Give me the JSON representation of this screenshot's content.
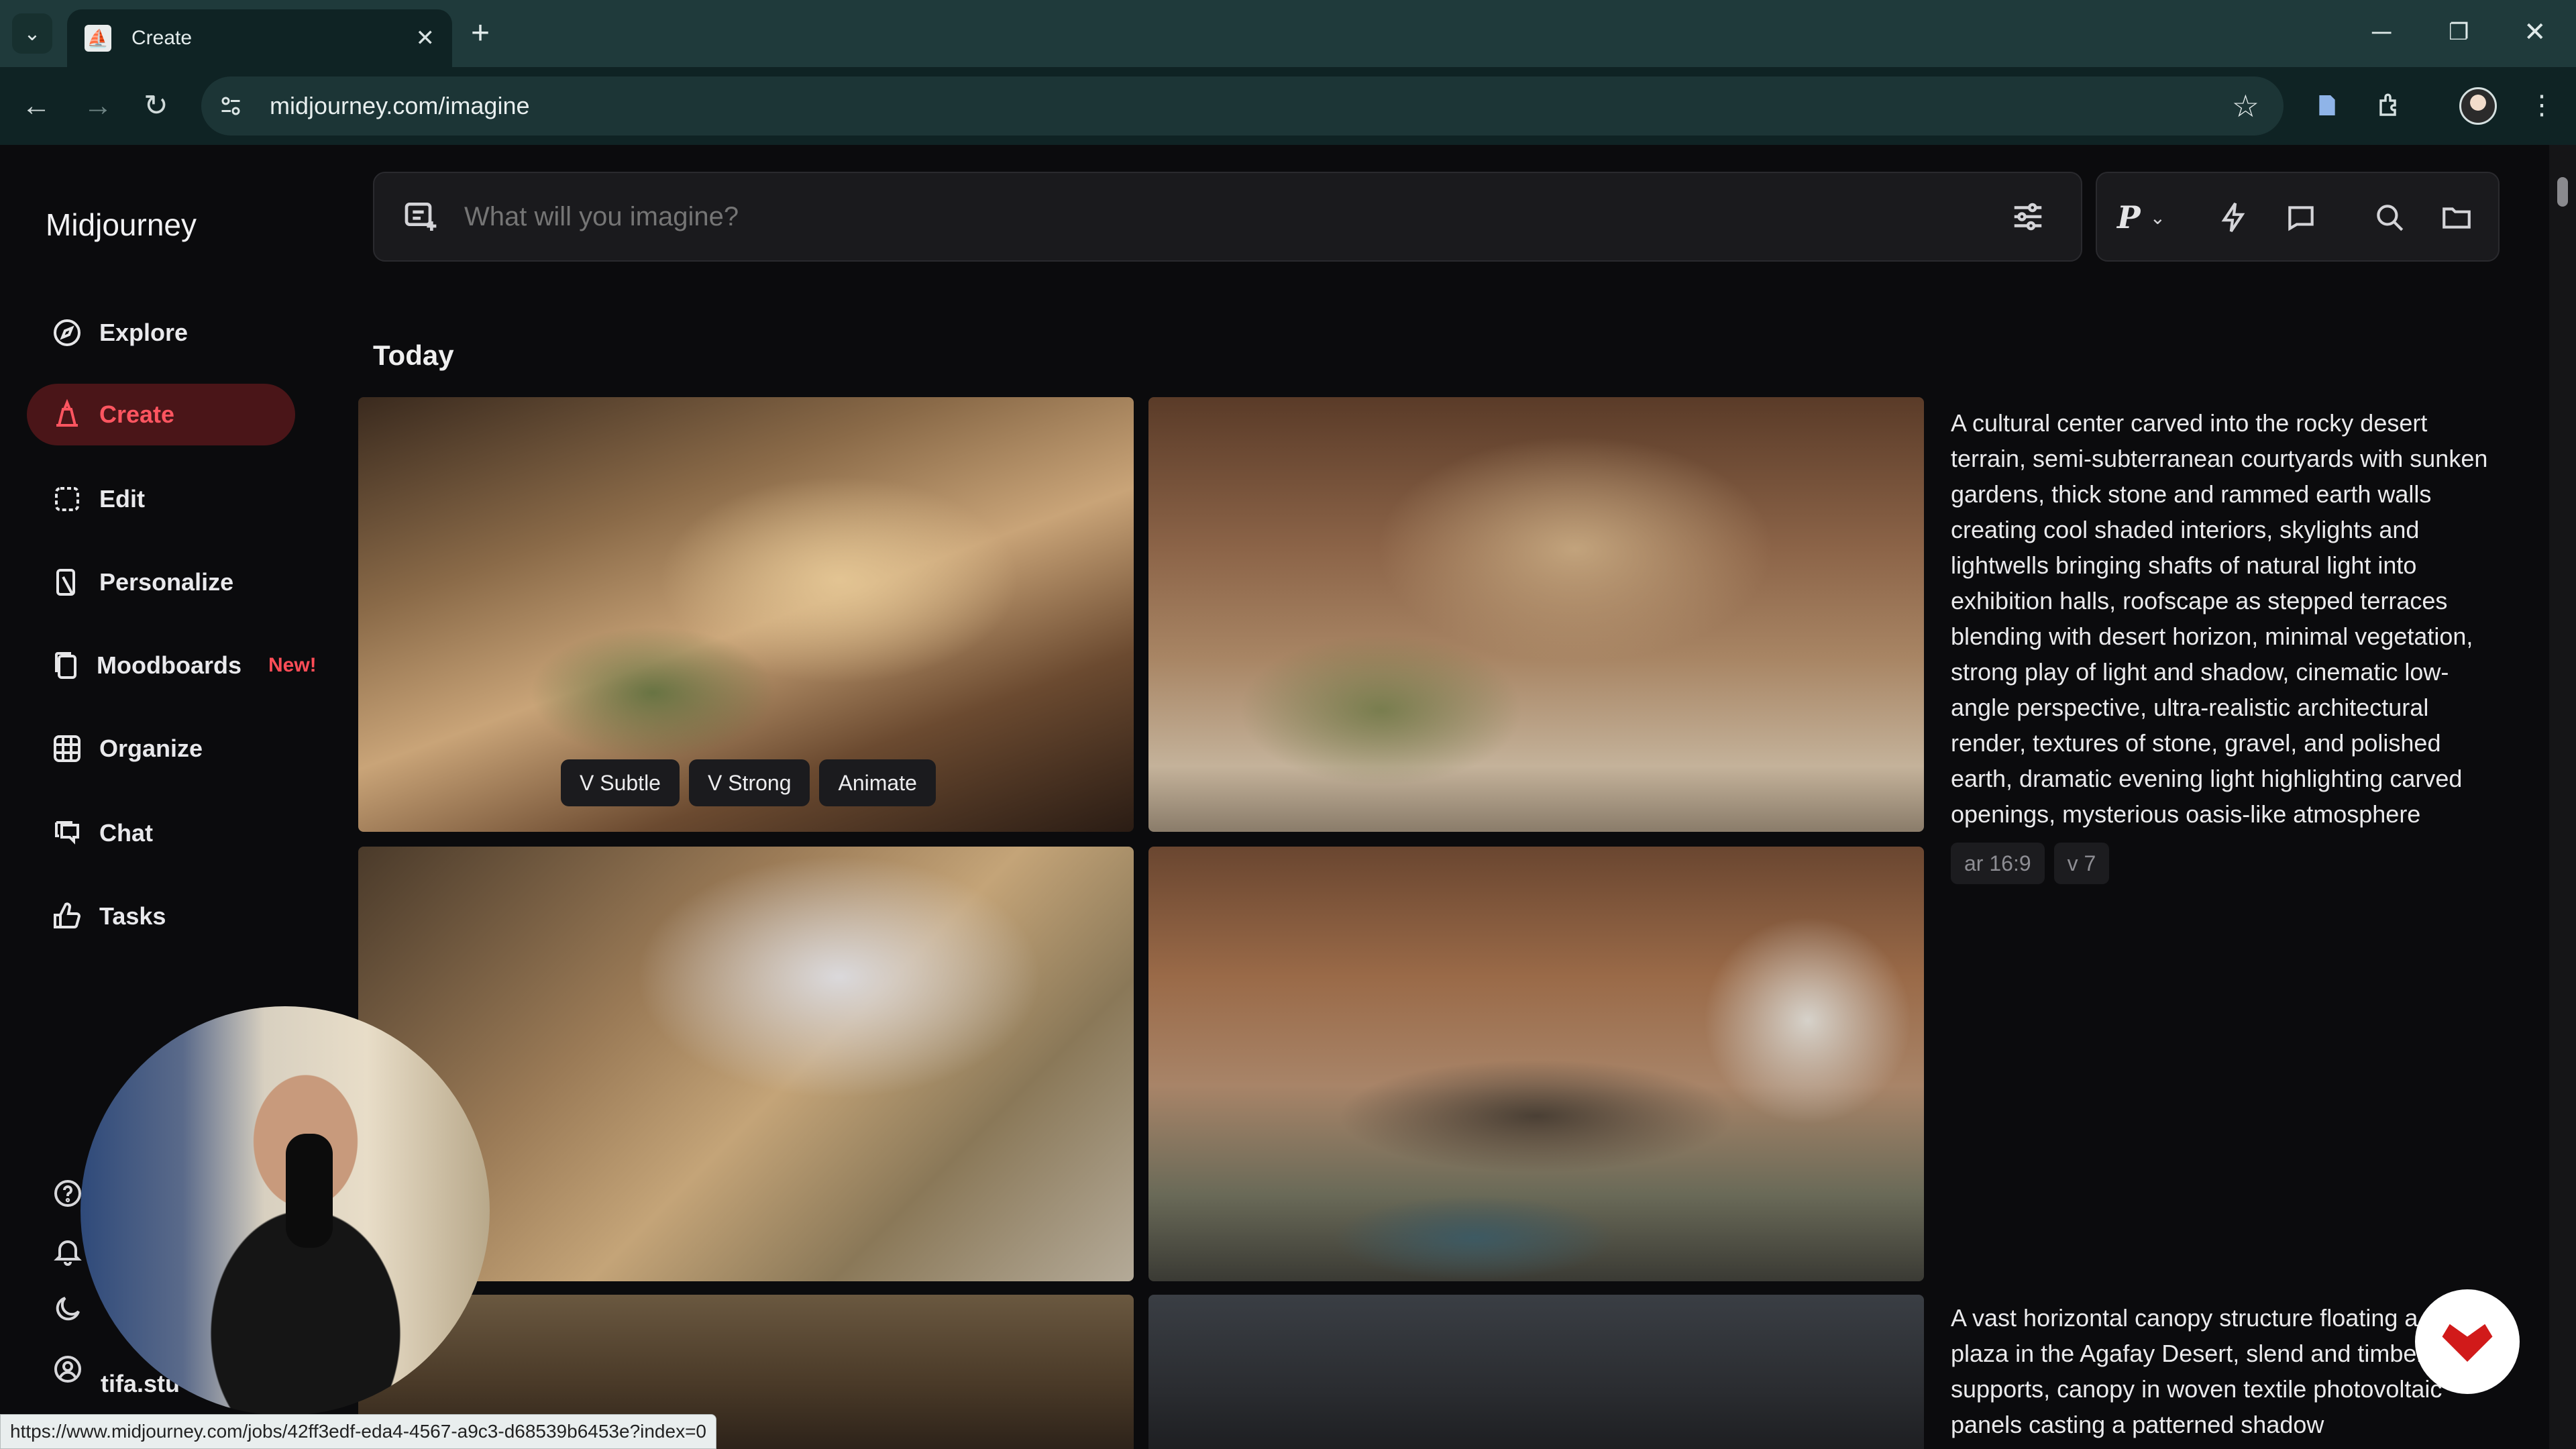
{
  "browser": {
    "tab_title": "Create",
    "url": "midjourney.com/imagine",
    "status_url": "https://www.midjourney.com/jobs/42ff3edf-eda4-4567-a9c3-d68539b6453e?index=0"
  },
  "sidebar": {
    "brand": "Midjourney",
    "items": [
      {
        "label": "Explore",
        "icon": "compass-icon"
      },
      {
        "label": "Create",
        "icon": "create-icon",
        "active": true
      },
      {
        "label": "Edit",
        "icon": "edit-icon"
      },
      {
        "label": "Personalize",
        "icon": "personalize-icon"
      },
      {
        "label": "Moodboards",
        "icon": "moodboards-icon",
        "badge": "New!"
      },
      {
        "label": "Organize",
        "icon": "grid-icon"
      },
      {
        "label": "Chat",
        "icon": "chat-icon"
      },
      {
        "label": "Tasks",
        "icon": "thumbs-up-icon"
      }
    ],
    "username": "tifa.stu"
  },
  "prompt_bar": {
    "placeholder": "What will you imagine?",
    "mode_label": "P"
  },
  "feed": {
    "section_title": "Today",
    "variation_buttons": [
      "V Subtle",
      "V Strong",
      "Animate"
    ],
    "prompt_1": "A cultural center carved into the rocky desert terrain, semi-subterranean courtyards with sunken gardens, thick stone and rammed earth walls creating cool shaded interiors, skylights and lightwells bringing shafts of natural light into exhibition halls, roofscape as stepped terraces blending with desert horizon, minimal vegetation, strong play of light and shadow, cinematic low-angle perspective, ultra-realistic architectural render, textures of stone, gravel, and polished earth, dramatic evening light highlighting carved openings, mysterious oasis-like atmosphere",
    "params_1": [
      "ar 16:9",
      "v 7"
    ],
    "prompt_2": "A vast horizontal canopy structure floating a cultural plaza in the Agafay Desert, slend and timber supports, canopy in woven textile photovoltaic panels casting a patterned shadow"
  },
  "colors": {
    "accent": "#ff4d57",
    "active_bg": "#4a1518",
    "background": "#0b0b0d"
  }
}
